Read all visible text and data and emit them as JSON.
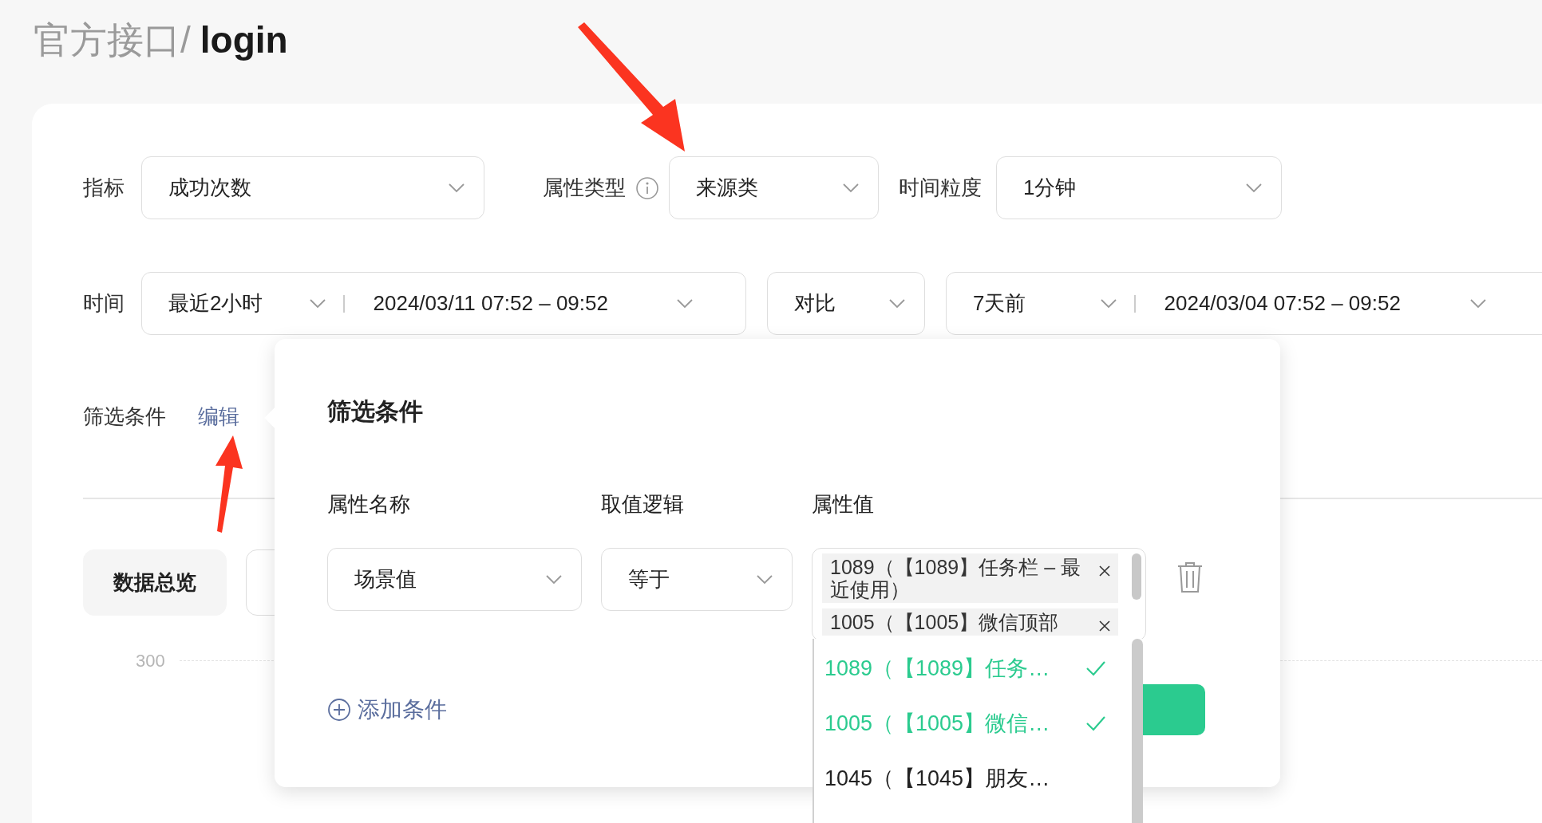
{
  "breadcrumb": {
    "parent": "官方接口/",
    "current": "login"
  },
  "metric_row": [
    {
      "label": "指标",
      "value": "成功次数",
      "info": false
    },
    {
      "label": "属性类型",
      "value": "来源类",
      "info": true
    },
    {
      "label": "时间粒度",
      "value": "1分钟",
      "info": false
    }
  ],
  "time_row": {
    "label": "时间",
    "range": "最近2小时",
    "dates": "2024/03/11 07:52 – 09:52",
    "compare": "对比",
    "compare_range": "7天前",
    "compare_dates": "2024/03/04 07:52 – 09:52"
  },
  "filter_row": {
    "label": "筛选条件",
    "edit_link": "编辑"
  },
  "view_tabs": [
    {
      "label": "数据总览",
      "selected": true
    },
    {
      "selected": false
    }
  ],
  "chart": {
    "y_tick": "300"
  },
  "filter_popover": {
    "title": "筛选条件",
    "columns": [
      "属性名称",
      "取值逻辑",
      "属性值"
    ],
    "conditions": [
      {
        "attribute": "场景值",
        "logic": "等于",
        "values": [
          "1089（【1089】任务栏 – 最近使用）",
          "1005（【1005】微信顶部"
        ]
      }
    ],
    "add_condition": "添加条件"
  },
  "value_dropdown": {
    "options": [
      {
        "label": "1089（【1089】任务…",
        "selected": true
      },
      {
        "label": "1005（【1005】微信…",
        "selected": true
      },
      {
        "label": "1045（【1045】朋友…",
        "selected": false
      }
    ]
  }
}
